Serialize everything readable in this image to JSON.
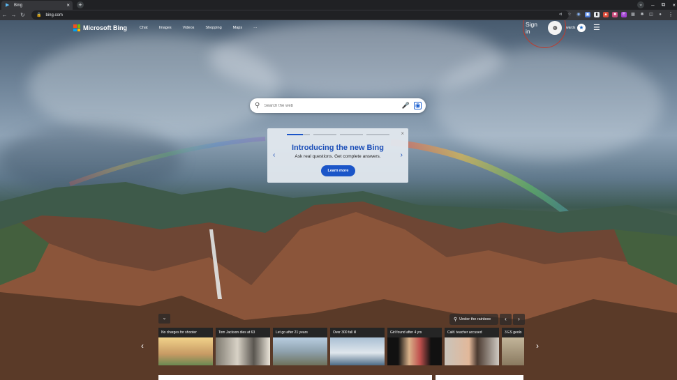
{
  "browser": {
    "tab_title": "Bing",
    "url": "bing.com"
  },
  "header": {
    "brand": "Microsoft Bing",
    "nav": [
      "Chat",
      "Images",
      "Videos",
      "Shopping",
      "Maps",
      "···"
    ],
    "signin_label": "Sign in",
    "rewards_label": "wards"
  },
  "search": {
    "placeholder": "Search the web"
  },
  "promo": {
    "title": "Introducing the new Bing",
    "subtitle": "Ask real questions. Get complete answers.",
    "button": "Learn more"
  },
  "news": {
    "location_label": "Under the rainbow",
    "items": [
      {
        "caption": "No charges for shooter"
      },
      {
        "caption": "Tom Jackson dies at 63"
      },
      {
        "caption": "Let go after 21 years"
      },
      {
        "caption": "Over 300 fall ill"
      },
      {
        "caption": "Girl found after 4 yrs"
      },
      {
        "caption": "Calif. teacher accused"
      },
      {
        "caption": "3 ES geolo"
      }
    ]
  },
  "colors": {
    "accent": "#1b55c8",
    "signin_highlight": "#c0392b"
  }
}
